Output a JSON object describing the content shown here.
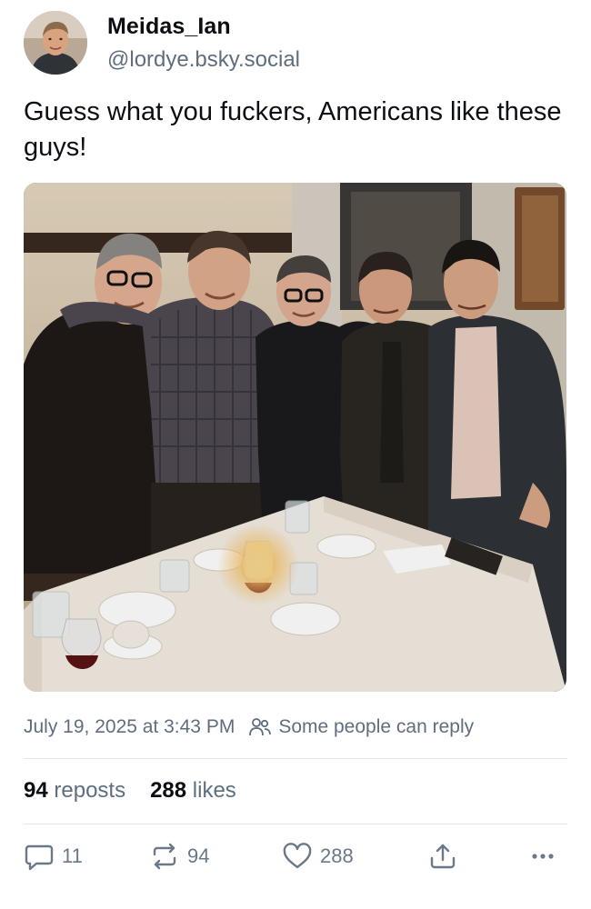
{
  "author": {
    "display_name": "Meidas_Ian",
    "handle": "@lordye.bsky.social",
    "avatar_icon": "user-avatar"
  },
  "post": {
    "text": "Guess what you fuckers, Americans like these guys!",
    "image_icon": "photo-of-five-men-at-dinner-table"
  },
  "meta": {
    "timestamp": "July 19, 2025 at 3:43 PM",
    "reply_setting": "Some people can reply",
    "reply_setting_icon": "people-icon"
  },
  "stats": {
    "reposts_count": "94",
    "reposts_label": "reposts",
    "likes_count": "288",
    "likes_label": "likes"
  },
  "actions": {
    "reply_count": "11",
    "repost_count": "94",
    "like_count": "288"
  },
  "colors": {
    "text": "#0b0f14",
    "secondary": "#5e6e7f",
    "icon": "#6a7888",
    "divider": "#e3e8ee"
  }
}
